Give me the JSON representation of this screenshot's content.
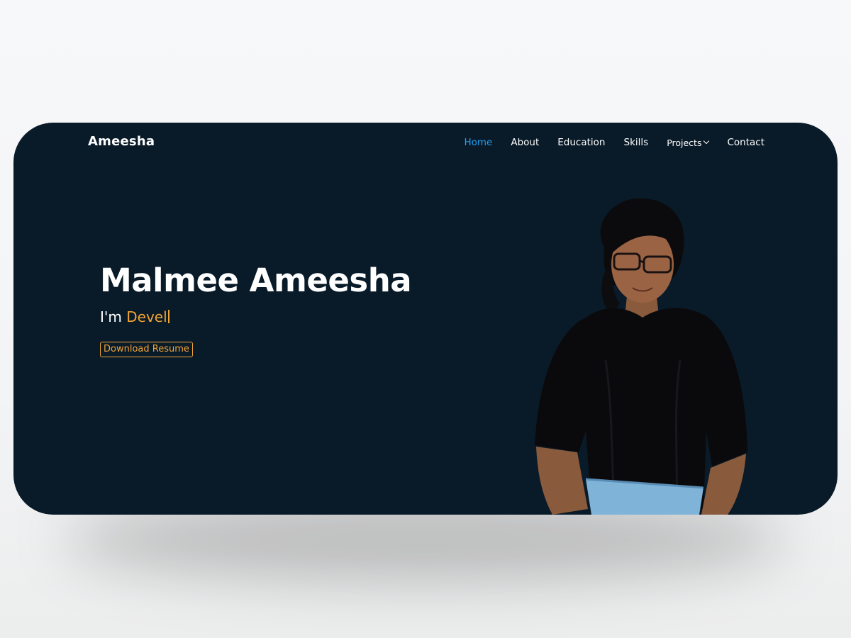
{
  "nav": {
    "brand": "Ameesha",
    "items": [
      {
        "label": "Home"
      },
      {
        "label": "About"
      },
      {
        "label": "Education"
      },
      {
        "label": "Skills"
      },
      {
        "label": "Projects"
      },
      {
        "label": "Contact"
      }
    ]
  },
  "hero": {
    "name": "Malmee Ameesha",
    "intro": "I'm",
    "typed_text": "Devel",
    "resume_label": "Download Resume"
  },
  "colors": {
    "background": "#091a28",
    "accent": "#f0a535",
    "active_nav": "#1ea0f0",
    "text": "#ffffff"
  },
  "icons": {
    "projects_dropdown": "chevron-down-icon"
  }
}
